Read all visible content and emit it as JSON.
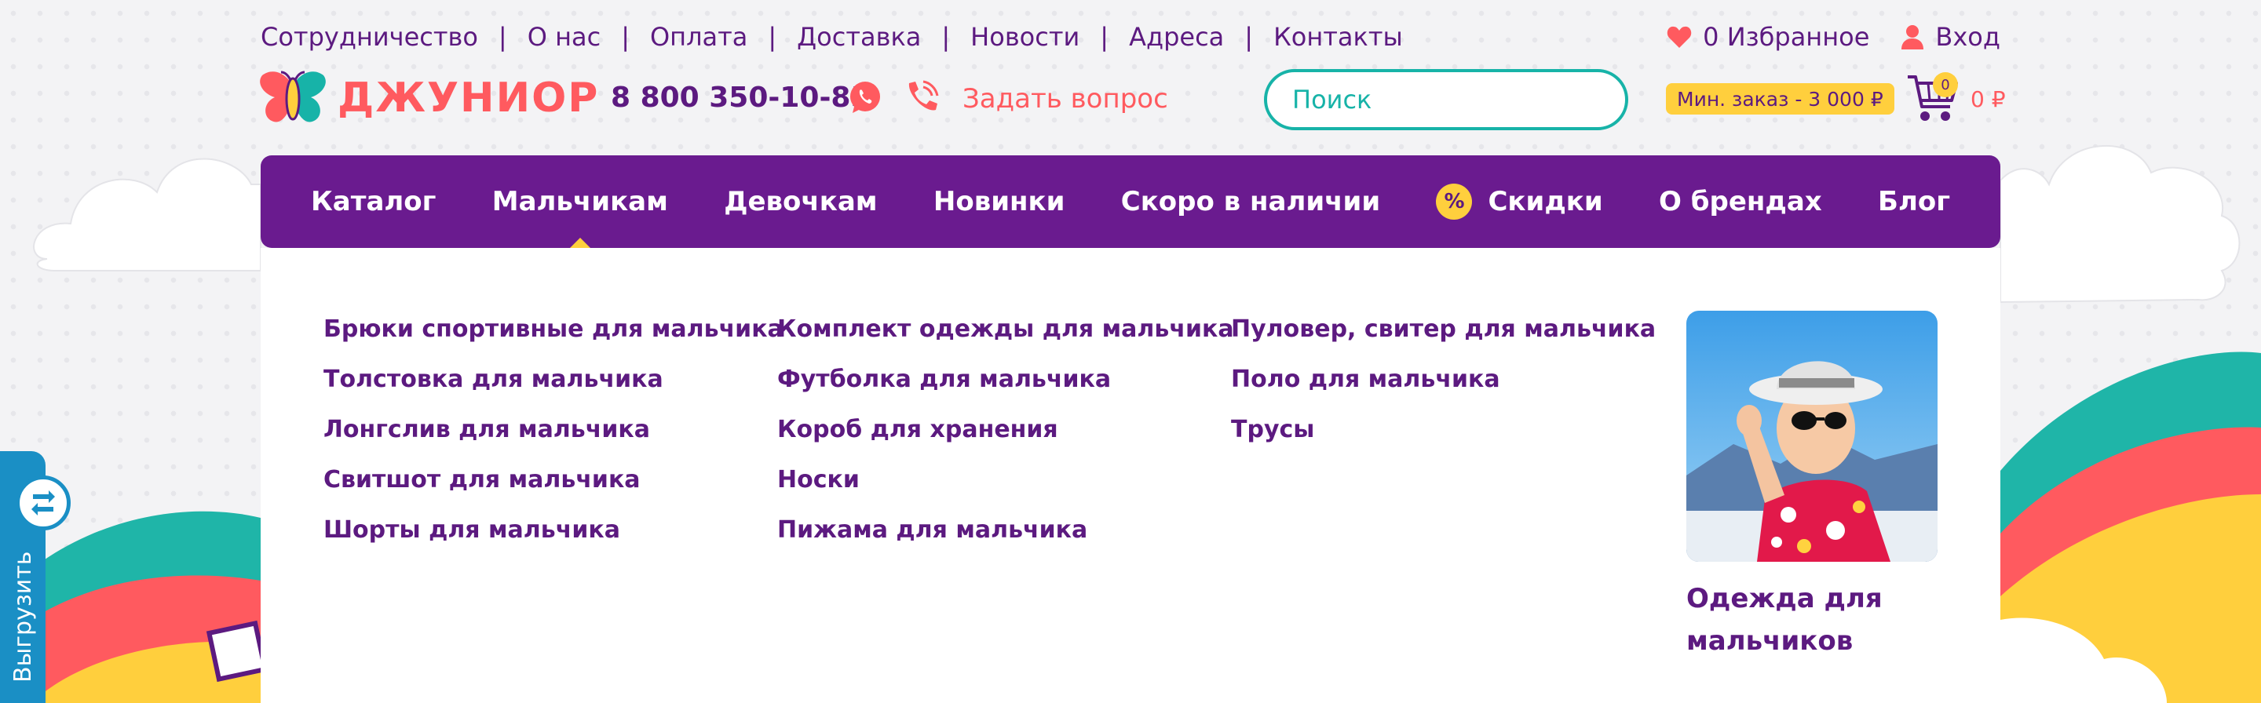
{
  "top_links": [
    "Сотрудничество",
    "О нас",
    "Оплата",
    "Доставка",
    "Новости",
    "Адреса",
    "Контакты"
  ],
  "top_separator": "|",
  "favorites_label": "0 Избранное",
  "login_label": "Вход",
  "logo_text": "ДЖУНИОР",
  "phone": "8 800 350-10-85",
  "ask_label": "Задать вопрос",
  "search_placeholder": "Поиск",
  "min_order": "Мин. заказ - 3 000 ₽",
  "cart_count": "0",
  "cart_sum": "0 ₽",
  "nav": {
    "catalog": "Каталог",
    "boys": "Мальчикам",
    "girls": "Девочкам",
    "new": "Новинки",
    "soon": "Скоро в наличии",
    "sale_icon": "%",
    "sale": "Скидки",
    "brands": "О брендах",
    "blog": "Блог"
  },
  "dropdown": {
    "col1": [
      "Брюки спортивные для мальчика",
      "Толстовка для мальчика",
      "Лонгслив для мальчика",
      "Свитшот для мальчика",
      "Шорты для мальчика"
    ],
    "col2": [
      "Комплект одежды для мальчика",
      "Футболка для мальчика",
      "Короб для хранения",
      "Носки",
      "Пижама для мальчика"
    ],
    "col3": [
      "Пуловер, свитер для мальчика",
      "Поло для мальчика",
      "Трусы"
    ],
    "promo_line1": "Одежда для",
    "promo_line2": "мальчиков"
  },
  "export_label": "Выгрузить",
  "colors": {
    "brand_purple": "#6a1b8f",
    "text_purple": "#5c1a80",
    "coral": "#ff5a5f",
    "teal": "#17b3a8",
    "yellow": "#ffcf3d",
    "export_blue": "#1a8fc5"
  },
  "icons": [
    "heart-icon",
    "user-icon",
    "butterfly-logo-icon",
    "whatsapp-icon",
    "phone-call-icon",
    "search-icon",
    "cart-icon",
    "export-icon"
  ]
}
